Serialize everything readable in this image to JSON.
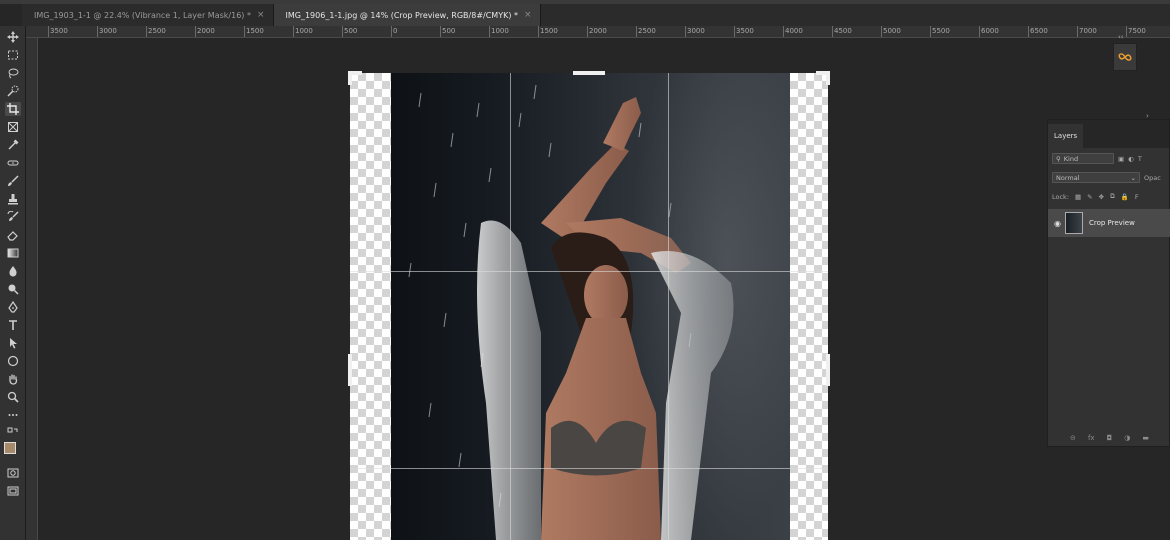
{
  "tabs": [
    {
      "label": "IMG_1903_1-1 @ 22.4% (Vibrance 1, Layer Mask/16) *",
      "active": false
    },
    {
      "label": "IMG_1906_1-1.jpg @ 14% (Crop Preview, RGB/8#/CMYK) *",
      "active": true
    }
  ],
  "close_glyph": "×",
  "ruler_labels": [
    "3500",
    "3000",
    "2500",
    "2000",
    "1500",
    "1000",
    "500",
    "0",
    "500",
    "1000",
    "1500",
    "2000",
    "2500",
    "3000",
    "3500",
    "4000",
    "4500",
    "5000",
    "5500",
    "6000",
    "6500",
    "7000",
    "7500"
  ],
  "toolbar_icons": [
    "move-icon",
    "marquee-icon",
    "lasso-icon",
    "quick-select-icon",
    "crop-icon",
    "frame-icon",
    "eyedropper-icon",
    "healing-brush-icon",
    "brush-icon",
    "clone-stamp-icon",
    "history-brush-icon",
    "eraser-icon",
    "gradient-icon",
    "blur-icon",
    "dodge-icon",
    "pen-icon",
    "type-icon",
    "path-select-icon",
    "ellipse-icon",
    "hand-icon",
    "zoom-icon",
    "more-tools-icon"
  ],
  "foreground_color": "#a88a6a",
  "background_color": "#111111",
  "layers_panel": {
    "tab_label": "Layers",
    "search_placeholder": "Kind",
    "blend_mode": "Normal",
    "opacity_label": "Opac",
    "lock_label": "Lock:",
    "fill_label": "F",
    "layer_name": "Crop Preview"
  }
}
